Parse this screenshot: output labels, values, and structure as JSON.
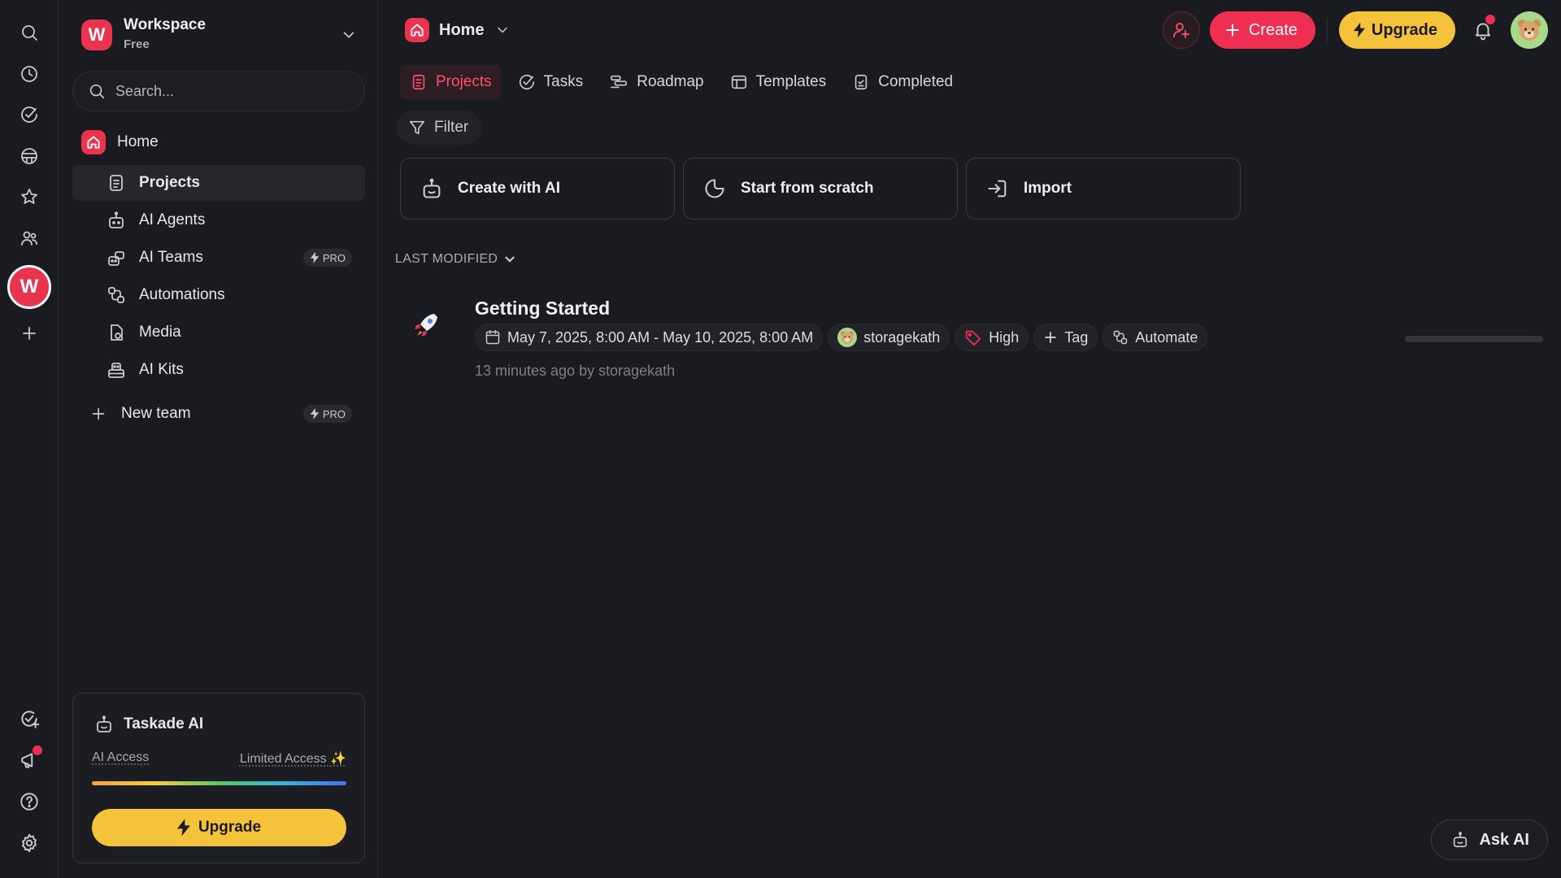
{
  "workspace": {
    "initial": "W",
    "name": "Workspace",
    "plan": "Free"
  },
  "search": {
    "placeholder": "Search..."
  },
  "sidebar": {
    "home_label": "Home",
    "items": [
      {
        "label": "Projects",
        "icon": "document-icon",
        "active": true
      },
      {
        "label": "AI Agents",
        "icon": "robot-icon"
      },
      {
        "label": "AI Teams",
        "icon": "robot-team-icon",
        "badge": "PRO"
      },
      {
        "label": "Automations",
        "icon": "automation-icon"
      },
      {
        "label": "Media",
        "icon": "media-icon"
      },
      {
        "label": "AI Kits",
        "icon": "kit-icon"
      }
    ],
    "new_team_label": "New team",
    "new_team_badge": "PRO"
  },
  "ai_card": {
    "title": "Taskade AI",
    "access_label": "AI Access",
    "access_value": "Limited Access ✨",
    "upgrade_label": "Upgrade"
  },
  "header": {
    "crumb": "Home",
    "create_label": "Create",
    "upgrade_label": "Upgrade"
  },
  "tabs": [
    {
      "label": "Projects",
      "icon": "document-icon",
      "active": true
    },
    {
      "label": "Tasks",
      "icon": "check-circle-icon"
    },
    {
      "label": "Roadmap",
      "icon": "roadmap-icon"
    },
    {
      "label": "Templates",
      "icon": "template-icon"
    },
    {
      "label": "Completed",
      "icon": "completed-icon"
    }
  ],
  "filter_label": "Filter",
  "actions": [
    {
      "label": "Create with AI",
      "icon": "robot-icon"
    },
    {
      "label": "Start from scratch",
      "icon": "blank-icon"
    },
    {
      "label": "Import",
      "icon": "import-icon"
    }
  ],
  "sort_label": "LAST MODIFIED",
  "project": {
    "title": "Getting Started",
    "icon": "rocket-icon",
    "dates": "May 7, 2025, 8:00 AM - May 10, 2025, 8:00 AM",
    "assignee": "storagekath",
    "priority": "High",
    "tag_label": "Tag",
    "automate_label": "Automate",
    "meta": "13 minutes ago by storagekath",
    "progress": 0.0
  },
  "ask_ai_label": "Ask AI",
  "colors": {
    "accent": "#ee2f52",
    "upgrade": "#f5c33b",
    "background": "#1a1b20"
  }
}
